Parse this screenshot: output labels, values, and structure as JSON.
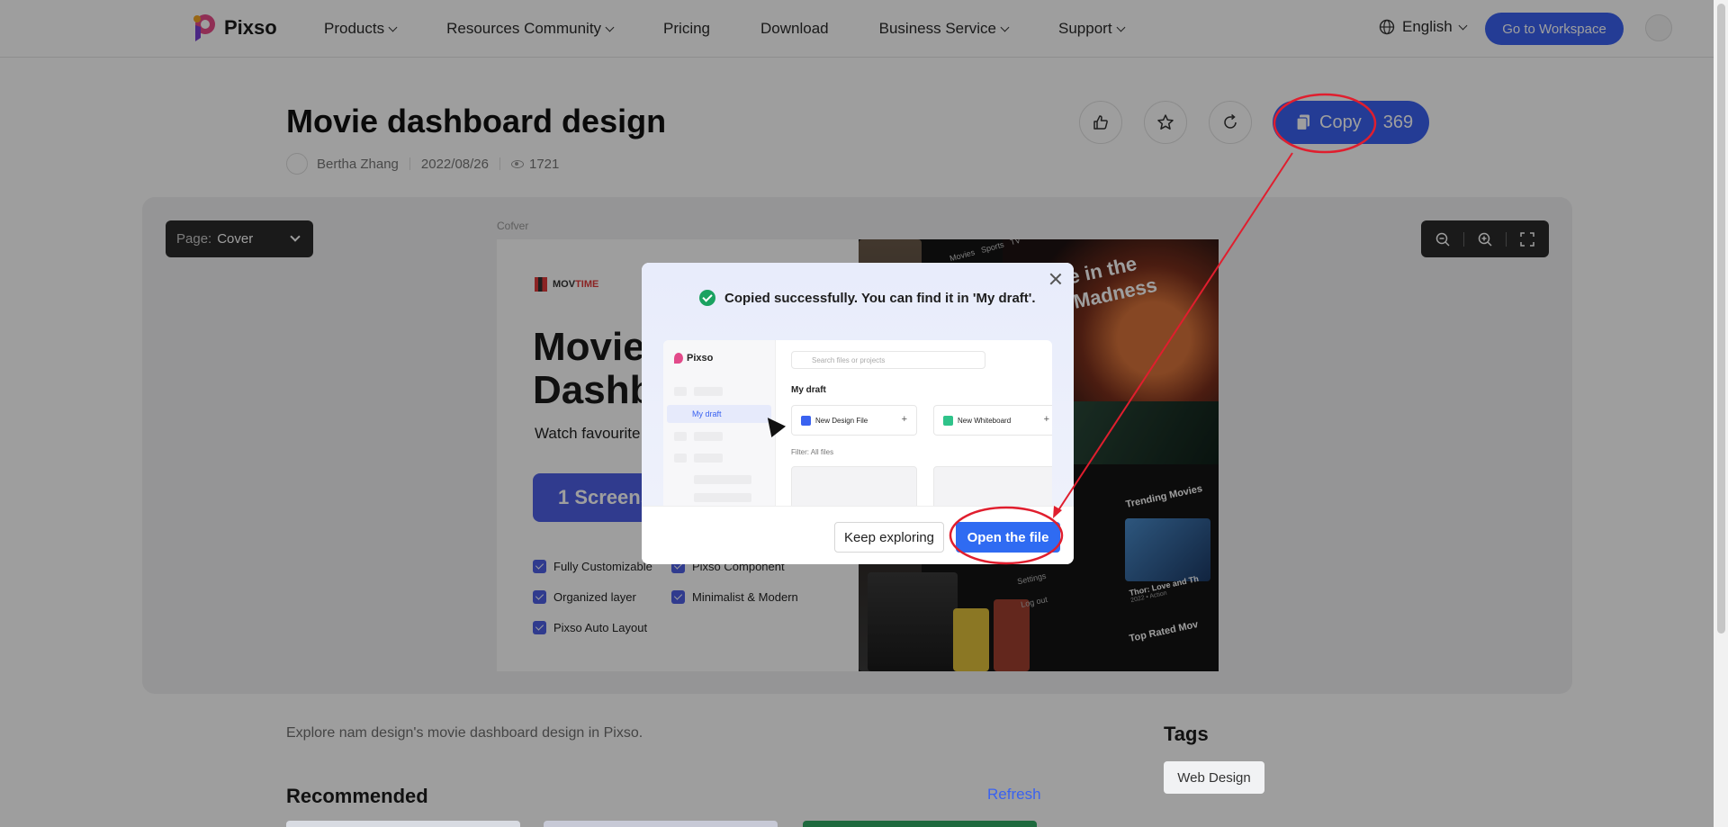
{
  "nav": {
    "brand": "Pixso",
    "items": [
      {
        "label": "Products",
        "dropdown": true
      },
      {
        "label": "Resources Community",
        "dropdown": true
      },
      {
        "label": "Pricing",
        "dropdown": false
      },
      {
        "label": "Download",
        "dropdown": false
      },
      {
        "label": "Business Service",
        "dropdown": true
      },
      {
        "label": "Support",
        "dropdown": true
      }
    ],
    "language": "English",
    "workspace_label": "Go to Workspace"
  },
  "header": {
    "title": "Movie dashboard design",
    "author": "Bertha Zhang",
    "date": "2022/08/26",
    "views": "1721",
    "copy_label": "Copy",
    "copy_count": "369"
  },
  "preview": {
    "page_prefix": "Page:",
    "page_name": "Cover",
    "frame_label": "Cofver",
    "cover": {
      "brand_a": "MOV",
      "brand_b": "TIME",
      "title_line1": "Movie",
      "title_line2": "Dashb",
      "subline": "Watch favourite",
      "screens_label": "1 Screens",
      "features": [
        "Fully Customizable",
        "Pixso Component",
        "Organized layer",
        "Minimalist & Modern",
        "Pixso Auto Layout"
      ]
    },
    "dark": {
      "tabs": [
        "Movies",
        "Sports",
        "TV"
      ],
      "headline_line1": "ge in the",
      "headline_line2": "f Madness",
      "trending": "Trending Movies",
      "movie_title": "Thor: Love and Th",
      "movie_meta": "2022 • Action",
      "settings": "Settings",
      "logout": "Log out",
      "top_rated": "Top Rated Mov"
    }
  },
  "modal": {
    "message": "Copied successfully. You can find it in 'My draft'.",
    "mini": {
      "brand": "Pixso",
      "search_placeholder": "Search files or projects",
      "my_draft_side": "My draft",
      "my_draft_heading": "My draft",
      "new_design": "New Design File",
      "new_whiteboard": "New Whiteboard",
      "filter": "Filter:  All files"
    },
    "keep_label": "Keep exploring",
    "open_label": "Open the file"
  },
  "below": {
    "description": "Explore nam design's movie dashboard design in Pixso.",
    "tags_heading": "Tags",
    "tag": "Web Design",
    "recommended": "Recommended",
    "refresh": "Refresh"
  },
  "colors": {
    "accent": "#3a62f0",
    "annotation": "#e01e2e"
  }
}
